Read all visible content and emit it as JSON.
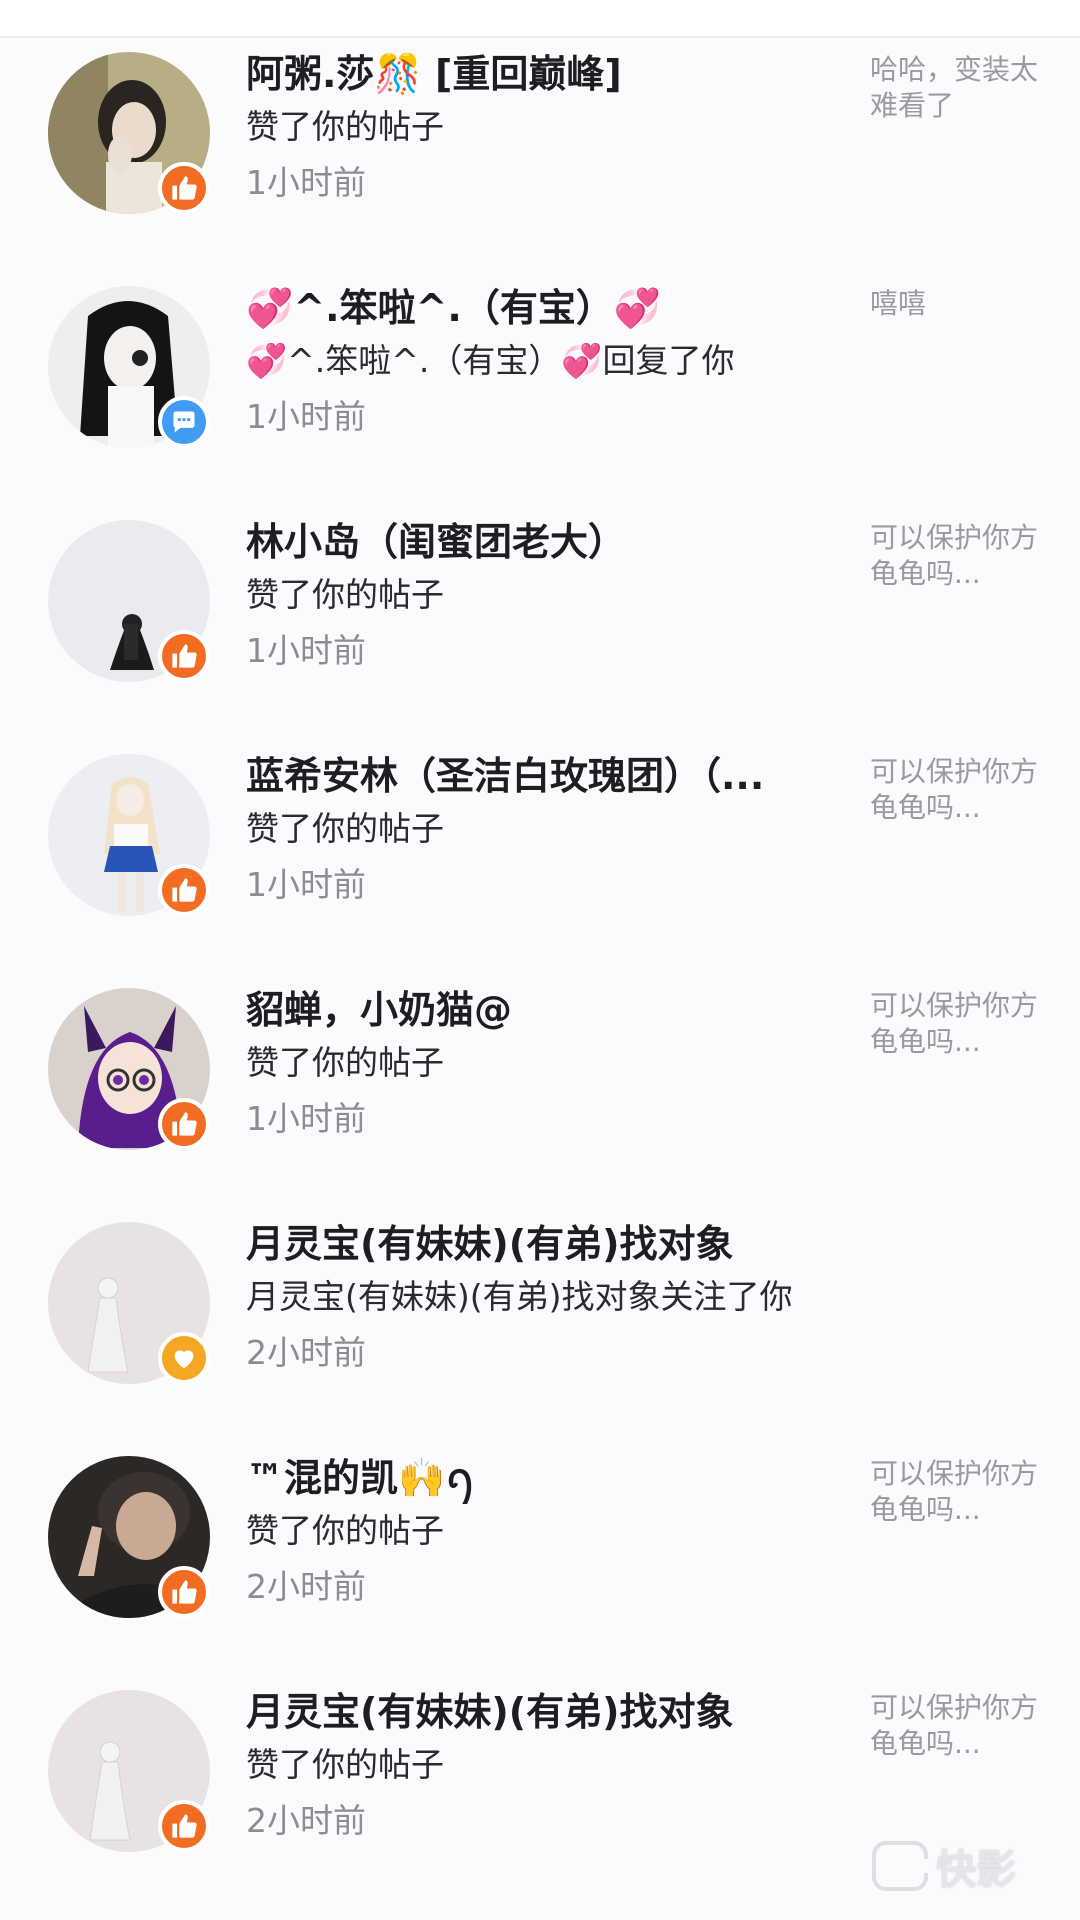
{
  "colors": {
    "like_badge": "#f26d21",
    "reply_badge": "#3f9cf0",
    "follow_badge": "#f5a623",
    "name_text": "#1d1d22",
    "time_text": "#8c8c94",
    "preview_text": "#9a9aa2"
  },
  "notifications": [
    {
      "name": "阿粥.莎🎊 [重回巅峰]",
      "action": "赞了你的帖子",
      "time": "1小时前",
      "preview": "哈哈，变装太难看了",
      "badge": "thumbs-up-icon"
    },
    {
      "name": "💞^.笨啦^.（有宝）💞",
      "action": "💞^.笨啦^.（有宝）💞回复了你",
      "time": "1小时前",
      "preview": "嘻嘻",
      "badge": "comment-icon"
    },
    {
      "name": "林小岛（闺蜜团老大）",
      "action": "赞了你的帖子",
      "time": "1小时前",
      "preview": "可以保护你方龟龟吗...",
      "badge": "thumbs-up-icon"
    },
    {
      "name": "蓝希安林（圣洁白玫瑰团）（...",
      "action": "赞了你的帖子",
      "time": "1小时前",
      "preview": "可以保护你方龟龟吗...",
      "badge": "thumbs-up-icon"
    },
    {
      "name": "貂蝉，小奶猫@",
      "action": "赞了你的帖子",
      "time": "1小时前",
      "preview": "可以保护你方龟龟吗...",
      "badge": "thumbs-up-icon"
    },
    {
      "name": "月灵宝(有妹妹)(有弟)找对象",
      "action": "月灵宝(有妹妹)(有弟)找对象关注了你",
      "time": "2小时前",
      "preview": "",
      "badge": "heart-icon"
    },
    {
      "name": "™混的凯🙌ꪆ",
      "action": "赞了你的帖子",
      "time": "2小时前",
      "preview": "可以保护你方龟龟吗...",
      "badge": "thumbs-up-icon"
    },
    {
      "name": "月灵宝(有妹妹)(有弟)找对象",
      "action": "赞了你的帖子",
      "time": "2小时前",
      "preview": "可以保护你方龟龟吗...",
      "badge": "thumbs-up-icon"
    }
  ],
  "watermark": {
    "text": "快影"
  }
}
